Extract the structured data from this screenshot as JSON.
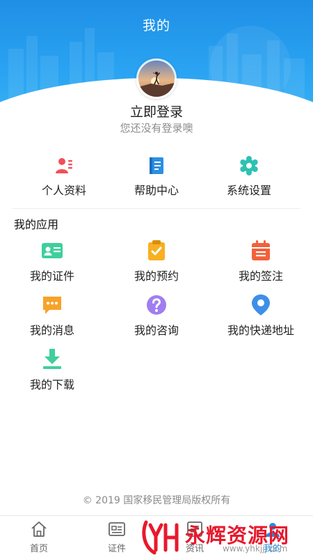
{
  "header": {
    "title": "我的"
  },
  "profile": {
    "login_label": "立即登录",
    "login_hint": "您还没有登录噢",
    "avatar_icon": "avatar-person-sunset"
  },
  "quick_links": [
    {
      "label": "个人资料",
      "icon": "profile-card-icon",
      "color": "#f0505a"
    },
    {
      "label": "帮助中心",
      "icon": "book-icon",
      "color": "#2d8fe2"
    },
    {
      "label": "系统设置",
      "icon": "gear-icon",
      "color": "#2cc2b2"
    }
  ],
  "apps": {
    "title": "我的应用",
    "items": [
      {
        "label": "我的证件",
        "icon": "id-card-icon",
        "color": "#3fcf9c"
      },
      {
        "label": "我的预约",
        "icon": "clipboard-check-icon",
        "color": "#f7b021"
      },
      {
        "label": "我的签注",
        "icon": "calendar-icon",
        "color": "#f3613a"
      },
      {
        "label": "我的消息",
        "icon": "message-icon",
        "color": "#f7a22a"
      },
      {
        "label": "我的咨询",
        "icon": "question-icon",
        "color": "#a07ef0"
      },
      {
        "label": "我的快递地址",
        "icon": "location-pin-icon",
        "color": "#3d8fe8"
      },
      {
        "label": "我的下载",
        "icon": "download-icon",
        "color": "#3fcf9c"
      }
    ]
  },
  "footer": {
    "copyright": "© 2019 国家移民管理局版权所有"
  },
  "tabbar": {
    "items": [
      {
        "label": "首页",
        "icon": "home-icon"
      },
      {
        "label": "证件",
        "icon": "document-icon"
      },
      {
        "label": "资讯",
        "icon": "news-icon"
      },
      {
        "label": "我的",
        "icon": "person-icon",
        "active": true
      }
    ]
  },
  "watermark": {
    "text": "永辉资源网",
    "url": "www.yhkjjj.com"
  }
}
